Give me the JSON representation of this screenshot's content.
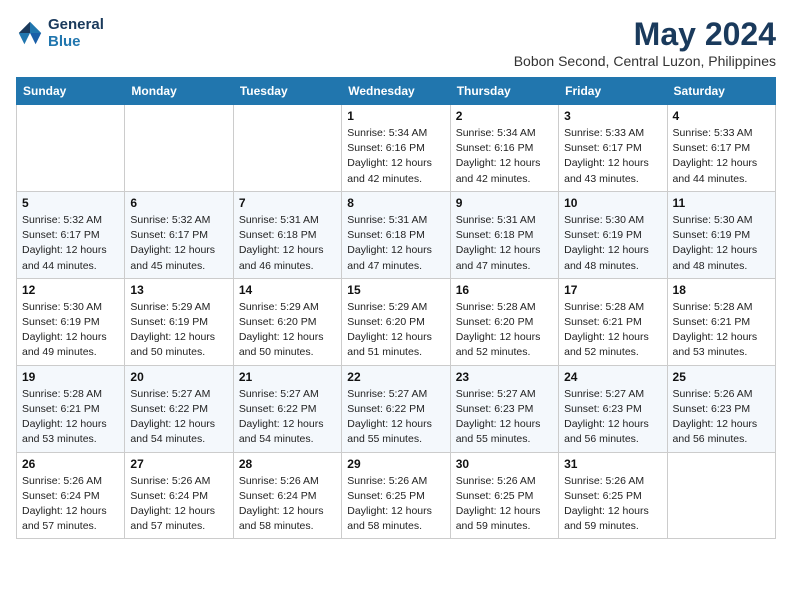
{
  "logo": {
    "line1": "General",
    "line2": "Blue"
  },
  "title": "May 2024",
  "location": "Bobon Second, Central Luzon, Philippines",
  "weekdays": [
    "Sunday",
    "Monday",
    "Tuesday",
    "Wednesday",
    "Thursday",
    "Friday",
    "Saturday"
  ],
  "weeks": [
    [
      {
        "day": "",
        "sunrise": "",
        "sunset": "",
        "daylight": ""
      },
      {
        "day": "",
        "sunrise": "",
        "sunset": "",
        "daylight": ""
      },
      {
        "day": "",
        "sunrise": "",
        "sunset": "",
        "daylight": ""
      },
      {
        "day": "1",
        "sunrise": "Sunrise: 5:34 AM",
        "sunset": "Sunset: 6:16 PM",
        "daylight": "Daylight: 12 hours and 42 minutes."
      },
      {
        "day": "2",
        "sunrise": "Sunrise: 5:34 AM",
        "sunset": "Sunset: 6:16 PM",
        "daylight": "Daylight: 12 hours and 42 minutes."
      },
      {
        "day": "3",
        "sunrise": "Sunrise: 5:33 AM",
        "sunset": "Sunset: 6:17 PM",
        "daylight": "Daylight: 12 hours and 43 minutes."
      },
      {
        "day": "4",
        "sunrise": "Sunrise: 5:33 AM",
        "sunset": "Sunset: 6:17 PM",
        "daylight": "Daylight: 12 hours and 44 minutes."
      }
    ],
    [
      {
        "day": "5",
        "sunrise": "Sunrise: 5:32 AM",
        "sunset": "Sunset: 6:17 PM",
        "daylight": "Daylight: 12 hours and 44 minutes."
      },
      {
        "day": "6",
        "sunrise": "Sunrise: 5:32 AM",
        "sunset": "Sunset: 6:17 PM",
        "daylight": "Daylight: 12 hours and 45 minutes."
      },
      {
        "day": "7",
        "sunrise": "Sunrise: 5:31 AM",
        "sunset": "Sunset: 6:18 PM",
        "daylight": "Daylight: 12 hours and 46 minutes."
      },
      {
        "day": "8",
        "sunrise": "Sunrise: 5:31 AM",
        "sunset": "Sunset: 6:18 PM",
        "daylight": "Daylight: 12 hours and 47 minutes."
      },
      {
        "day": "9",
        "sunrise": "Sunrise: 5:31 AM",
        "sunset": "Sunset: 6:18 PM",
        "daylight": "Daylight: 12 hours and 47 minutes."
      },
      {
        "day": "10",
        "sunrise": "Sunrise: 5:30 AM",
        "sunset": "Sunset: 6:19 PM",
        "daylight": "Daylight: 12 hours and 48 minutes."
      },
      {
        "day": "11",
        "sunrise": "Sunrise: 5:30 AM",
        "sunset": "Sunset: 6:19 PM",
        "daylight": "Daylight: 12 hours and 48 minutes."
      }
    ],
    [
      {
        "day": "12",
        "sunrise": "Sunrise: 5:30 AM",
        "sunset": "Sunset: 6:19 PM",
        "daylight": "Daylight: 12 hours and 49 minutes."
      },
      {
        "day": "13",
        "sunrise": "Sunrise: 5:29 AM",
        "sunset": "Sunset: 6:19 PM",
        "daylight": "Daylight: 12 hours and 50 minutes."
      },
      {
        "day": "14",
        "sunrise": "Sunrise: 5:29 AM",
        "sunset": "Sunset: 6:20 PM",
        "daylight": "Daylight: 12 hours and 50 minutes."
      },
      {
        "day": "15",
        "sunrise": "Sunrise: 5:29 AM",
        "sunset": "Sunset: 6:20 PM",
        "daylight": "Daylight: 12 hours and 51 minutes."
      },
      {
        "day": "16",
        "sunrise": "Sunrise: 5:28 AM",
        "sunset": "Sunset: 6:20 PM",
        "daylight": "Daylight: 12 hours and 52 minutes."
      },
      {
        "day": "17",
        "sunrise": "Sunrise: 5:28 AM",
        "sunset": "Sunset: 6:21 PM",
        "daylight": "Daylight: 12 hours and 52 minutes."
      },
      {
        "day": "18",
        "sunrise": "Sunrise: 5:28 AM",
        "sunset": "Sunset: 6:21 PM",
        "daylight": "Daylight: 12 hours and 53 minutes."
      }
    ],
    [
      {
        "day": "19",
        "sunrise": "Sunrise: 5:28 AM",
        "sunset": "Sunset: 6:21 PM",
        "daylight": "Daylight: 12 hours and 53 minutes."
      },
      {
        "day": "20",
        "sunrise": "Sunrise: 5:27 AM",
        "sunset": "Sunset: 6:22 PM",
        "daylight": "Daylight: 12 hours and 54 minutes."
      },
      {
        "day": "21",
        "sunrise": "Sunrise: 5:27 AM",
        "sunset": "Sunset: 6:22 PM",
        "daylight": "Daylight: 12 hours and 54 minutes."
      },
      {
        "day": "22",
        "sunrise": "Sunrise: 5:27 AM",
        "sunset": "Sunset: 6:22 PM",
        "daylight": "Daylight: 12 hours and 55 minutes."
      },
      {
        "day": "23",
        "sunrise": "Sunrise: 5:27 AM",
        "sunset": "Sunset: 6:23 PM",
        "daylight": "Daylight: 12 hours and 55 minutes."
      },
      {
        "day": "24",
        "sunrise": "Sunrise: 5:27 AM",
        "sunset": "Sunset: 6:23 PM",
        "daylight": "Daylight: 12 hours and 56 minutes."
      },
      {
        "day": "25",
        "sunrise": "Sunrise: 5:26 AM",
        "sunset": "Sunset: 6:23 PM",
        "daylight": "Daylight: 12 hours and 56 minutes."
      }
    ],
    [
      {
        "day": "26",
        "sunrise": "Sunrise: 5:26 AM",
        "sunset": "Sunset: 6:24 PM",
        "daylight": "Daylight: 12 hours and 57 minutes."
      },
      {
        "day": "27",
        "sunrise": "Sunrise: 5:26 AM",
        "sunset": "Sunset: 6:24 PM",
        "daylight": "Daylight: 12 hours and 57 minutes."
      },
      {
        "day": "28",
        "sunrise": "Sunrise: 5:26 AM",
        "sunset": "Sunset: 6:24 PM",
        "daylight": "Daylight: 12 hours and 58 minutes."
      },
      {
        "day": "29",
        "sunrise": "Sunrise: 5:26 AM",
        "sunset": "Sunset: 6:25 PM",
        "daylight": "Daylight: 12 hours and 58 minutes."
      },
      {
        "day": "30",
        "sunrise": "Sunrise: 5:26 AM",
        "sunset": "Sunset: 6:25 PM",
        "daylight": "Daylight: 12 hours and 59 minutes."
      },
      {
        "day": "31",
        "sunrise": "Sunrise: 5:26 AM",
        "sunset": "Sunset: 6:25 PM",
        "daylight": "Daylight: 12 hours and 59 minutes."
      },
      {
        "day": "",
        "sunrise": "",
        "sunset": "",
        "daylight": ""
      }
    ]
  ]
}
